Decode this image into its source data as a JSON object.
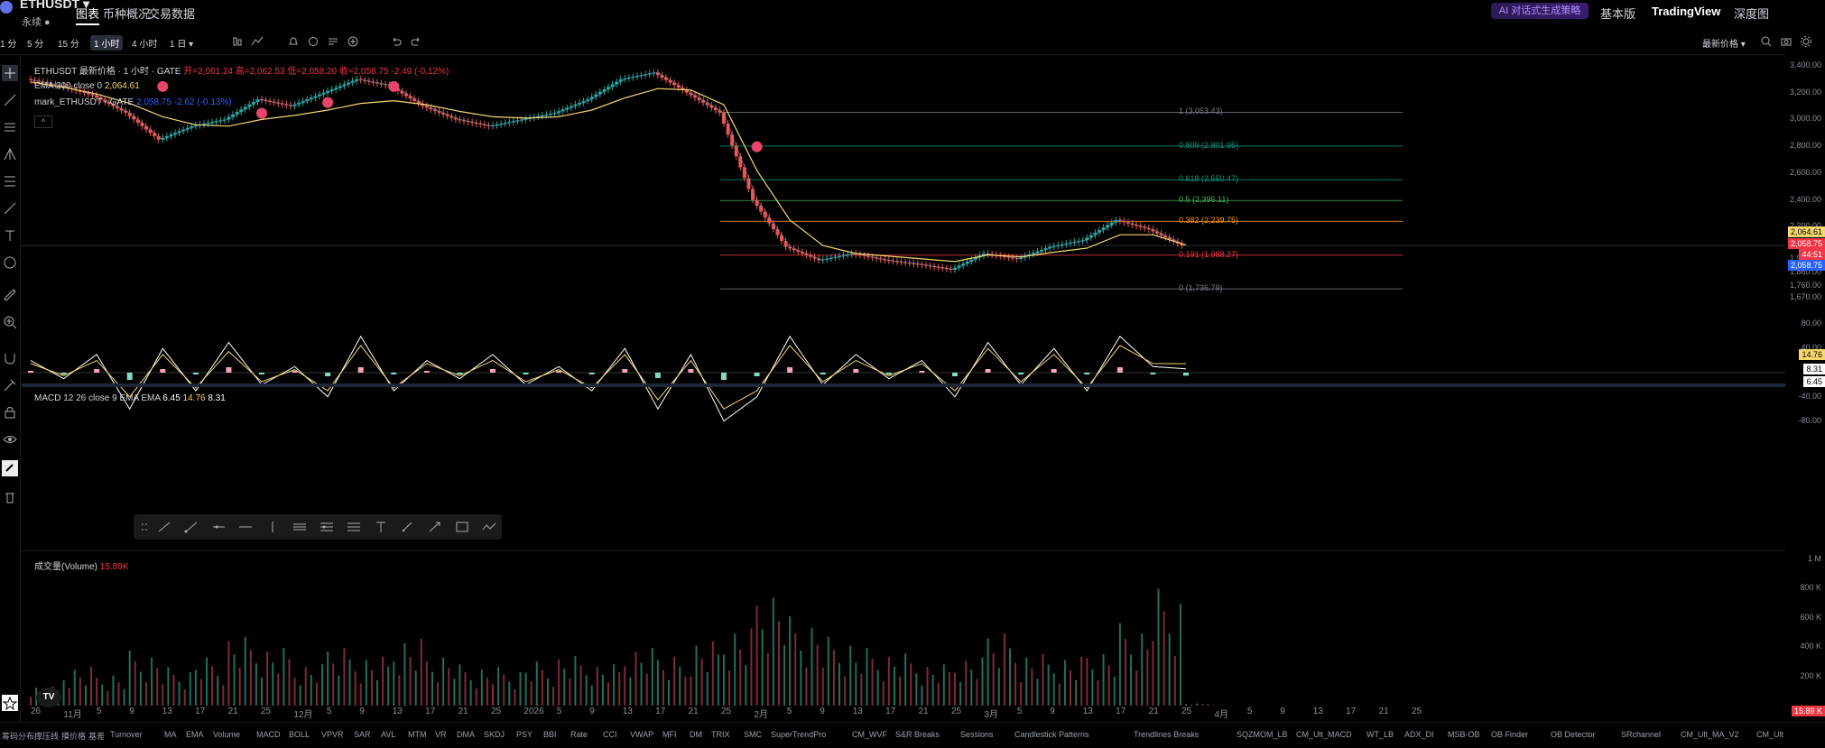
{
  "header": {
    "symbol": "ETHUSDT ▾",
    "contract": "永续 ●",
    "tabs": [
      {
        "label": "图表",
        "active": true
      },
      {
        "label": "币种概况",
        "active": false
      },
      {
        "label": "交易数据",
        "active": false
      }
    ],
    "ai_button": "AI 对话式生成策略",
    "right_tabs": [
      "基本版",
      "TradingView",
      "深度图"
    ]
  },
  "toolbar": {
    "timeframes": [
      "1 分",
      "5 分",
      "15 分",
      "1 小时",
      "4 小时",
      "1 日 ▾"
    ],
    "active_timeframe": "1 小时",
    "price_mode": "最新价格 ▾"
  },
  "legend": {
    "title_line": "ETHUSDT 最新价格 · 1 小时 · GATE",
    "ohlc": "开=2,061.24 高=2,062.53 低=2,058.20 收=2,058.75 -2.49 (-0.12%)",
    "ema_label": "EMA 200 close 0",
    "ema_value": "2,064.61",
    "mark_label": "mark_ETHUSDT - GATE",
    "mark_value": "2,058.75 -2.62 (-0.13%)",
    "macd_label": "MACD 12 26 close 9 EMA EMA",
    "macd_v1": "6.45",
    "macd_v2": "14.76",
    "macd_v3": "8.31",
    "volume_label": "成交量(Volume)",
    "volume_value": "15.89K"
  },
  "fib_levels": [
    {
      "label": "1 (3,053.43)",
      "price": 3053.43,
      "color": "#787b86"
    },
    {
      "label": "0.809 (2,801.95)",
      "price": 2801.95,
      "color": "#089981"
    },
    {
      "label": "0.618 (2,550.47)",
      "price": 2550.47,
      "color": "#089981"
    },
    {
      "label": "0.5 (2,395.11)",
      "price": 2395.11,
      "color": "#4caf50"
    },
    {
      "label": "0.382 (2,239.75)",
      "price": 2239.75,
      "color": "#ff9800"
    },
    {
      "label": "0.191 (1,988.27)",
      "price": 1988.27,
      "color": "#f23645"
    },
    {
      "label": "0 (1,736.79)",
      "price": 1736.79,
      "color": "#787b86"
    }
  ],
  "price_axis": {
    "main": [
      "3,400.00",
      "3,200.00",
      "3,000.00",
      "2,800.00",
      "2,600.00",
      "2,400.00",
      "2,200.00",
      "1,960.00",
      "1,860.00",
      "1,760.00",
      "1,670.00"
    ],
    "macd": [
      "80.00",
      "40.00",
      "-40.00",
      "-80.00"
    ],
    "volume": [
      "1 M",
      "800 K",
      "600 K",
      "400 K",
      "200 K"
    ],
    "tags": {
      "ema": "2,064.61",
      "last": "2,058.75",
      "countdown": "44:51",
      "mark": "2,058.75",
      "macd_signal": "14.76",
      "macd_hist": "8.31",
      "macd_line": "6.45",
      "volume": "15.89 K"
    }
  },
  "time_axis": [
    "26",
    "11月",
    "5",
    "9",
    "13",
    "17",
    "21",
    "25",
    "12月",
    "5",
    "9",
    "13",
    "17",
    "21",
    "25",
    "2026",
    "5",
    "9",
    "13",
    "17",
    "21",
    "25",
    "2月",
    "5",
    "9",
    "13",
    "17",
    "21",
    "25",
    "3月",
    "5",
    "9",
    "13",
    "17",
    "21",
    "25",
    "4月",
    "5",
    "9",
    "13",
    "17",
    "21",
    "25"
  ],
  "bottom_indicators": [
    "筹码分布",
    "撑压线",
    "摸价格",
    "基差",
    "Turnover",
    "MA",
    "EMA",
    "Volume",
    "MACD",
    "BOLL",
    "VPVR",
    "SAR",
    "AVL",
    "MTM",
    "VR",
    "DMA",
    "SKDJ",
    "PSY",
    "BBI",
    "Rate",
    "CCI",
    "VWAP",
    "MFI",
    "DM",
    "TRIX",
    "SMC",
    "SuperTrendPro",
    "CM_WVF",
    "S&R Breaks",
    "Sessions",
    "Candlestick Patterns",
    "Trendlines Breaks",
    "SQZMOM_LB",
    "CM_Ult_MACD",
    "WT_LB",
    "ADX_DI",
    "MSB-OB",
    "OB Finder",
    "OB Detector",
    "SRchannel",
    "CM_Ult_MA_V2",
    "CM_Ult"
  ],
  "chart_data": {
    "type": "line",
    "title": "ETHUSDT 最新价格 · 1 小时 · GATE",
    "xlabel": "",
    "ylabel": "",
    "ylim": [
      1670,
      3420
    ],
    "x": [
      "26",
      "11月",
      "5",
      "9",
      "13",
      "17",
      "21",
      "25",
      "12月",
      "5",
      "9",
      "13",
      "17",
      "21",
      "25",
      "2026",
      "5",
      "9",
      "13",
      "17",
      "21",
      "25",
      "2月",
      "5",
      "9",
      "13",
      "17",
      "21",
      "25",
      "3月",
      "5",
      "9",
      "13",
      "17",
      "21",
      "25"
    ],
    "series": [
      {
        "name": "ETHUSDT",
        "values": [
          3300,
          3250,
          3180,
          3050,
          2850,
          2950,
          3000,
          3150,
          3100,
          3200,
          3300,
          3250,
          3100,
          3000,
          2950,
          3000,
          3050,
          3150,
          3300,
          3350,
          3200,
          3050,
          2400,
          2050,
          1950,
          2000,
          1950,
          1920,
          1880,
          2000,
          1960,
          2050,
          2100,
          2250,
          2180,
          2060
        ]
      },
      {
        "name": "EMA 200 close 0",
        "values": [
          3280,
          3240,
          3190,
          3120,
          3020,
          2960,
          2950,
          3000,
          3030,
          3070,
          3120,
          3140,
          3110,
          3060,
          3020,
          3010,
          3020,
          3070,
          3160,
          3230,
          3220,
          3110,
          2620,
          2250,
          2060,
          2000,
          1980,
          1960,
          1940,
          1990,
          1975,
          2010,
          2040,
          2140,
          2140,
          2064.61
        ]
      }
    ],
    "macd": {
      "name": "MACD 12 26 close 9 EMA EMA",
      "ylim": [
        -100,
        100
      ],
      "line": [
        20,
        -10,
        30,
        -60,
        40,
        -30,
        50,
        -20,
        10,
        -40,
        60,
        -30,
        20,
        -10,
        30,
        -20,
        10,
        -30,
        40,
        -60,
        30,
        -80,
        -40,
        60,
        -20,
        30,
        -10,
        20,
        -40,
        50,
        -20,
        40,
        -30,
        60,
        10,
        6.45
      ],
      "signal": [
        15,
        -5,
        20,
        -40,
        30,
        -25,
        35,
        -15,
        5,
        -30,
        45,
        -25,
        15,
        -5,
        20,
        -15,
        5,
        -25,
        30,
        -45,
        20,
        -60,
        -30,
        45,
        -15,
        20,
        -5,
        15,
        -30,
        40,
        -15,
        30,
        -25,
        45,
        15,
        14.76
      ]
    },
    "volume": {
      "name": "成交量(Volume)",
      "ylim": [
        0,
        1000000
      ],
      "values": [
        150000,
        300000,
        250000,
        400000,
        280000,
        350000,
        500000,
        420000,
        300000,
        450000,
        380000,
        520000,
        400000,
        300000,
        280000,
        320000,
        360000,
        300000,
        420000,
        380000,
        500000,
        600000,
        900000,
        650000,
        500000,
        420000,
        380000,
        300000,
        350000,
        560000,
        400000,
        380000,
        430000,
        600000,
        850000,
        15890
      ]
    }
  }
}
